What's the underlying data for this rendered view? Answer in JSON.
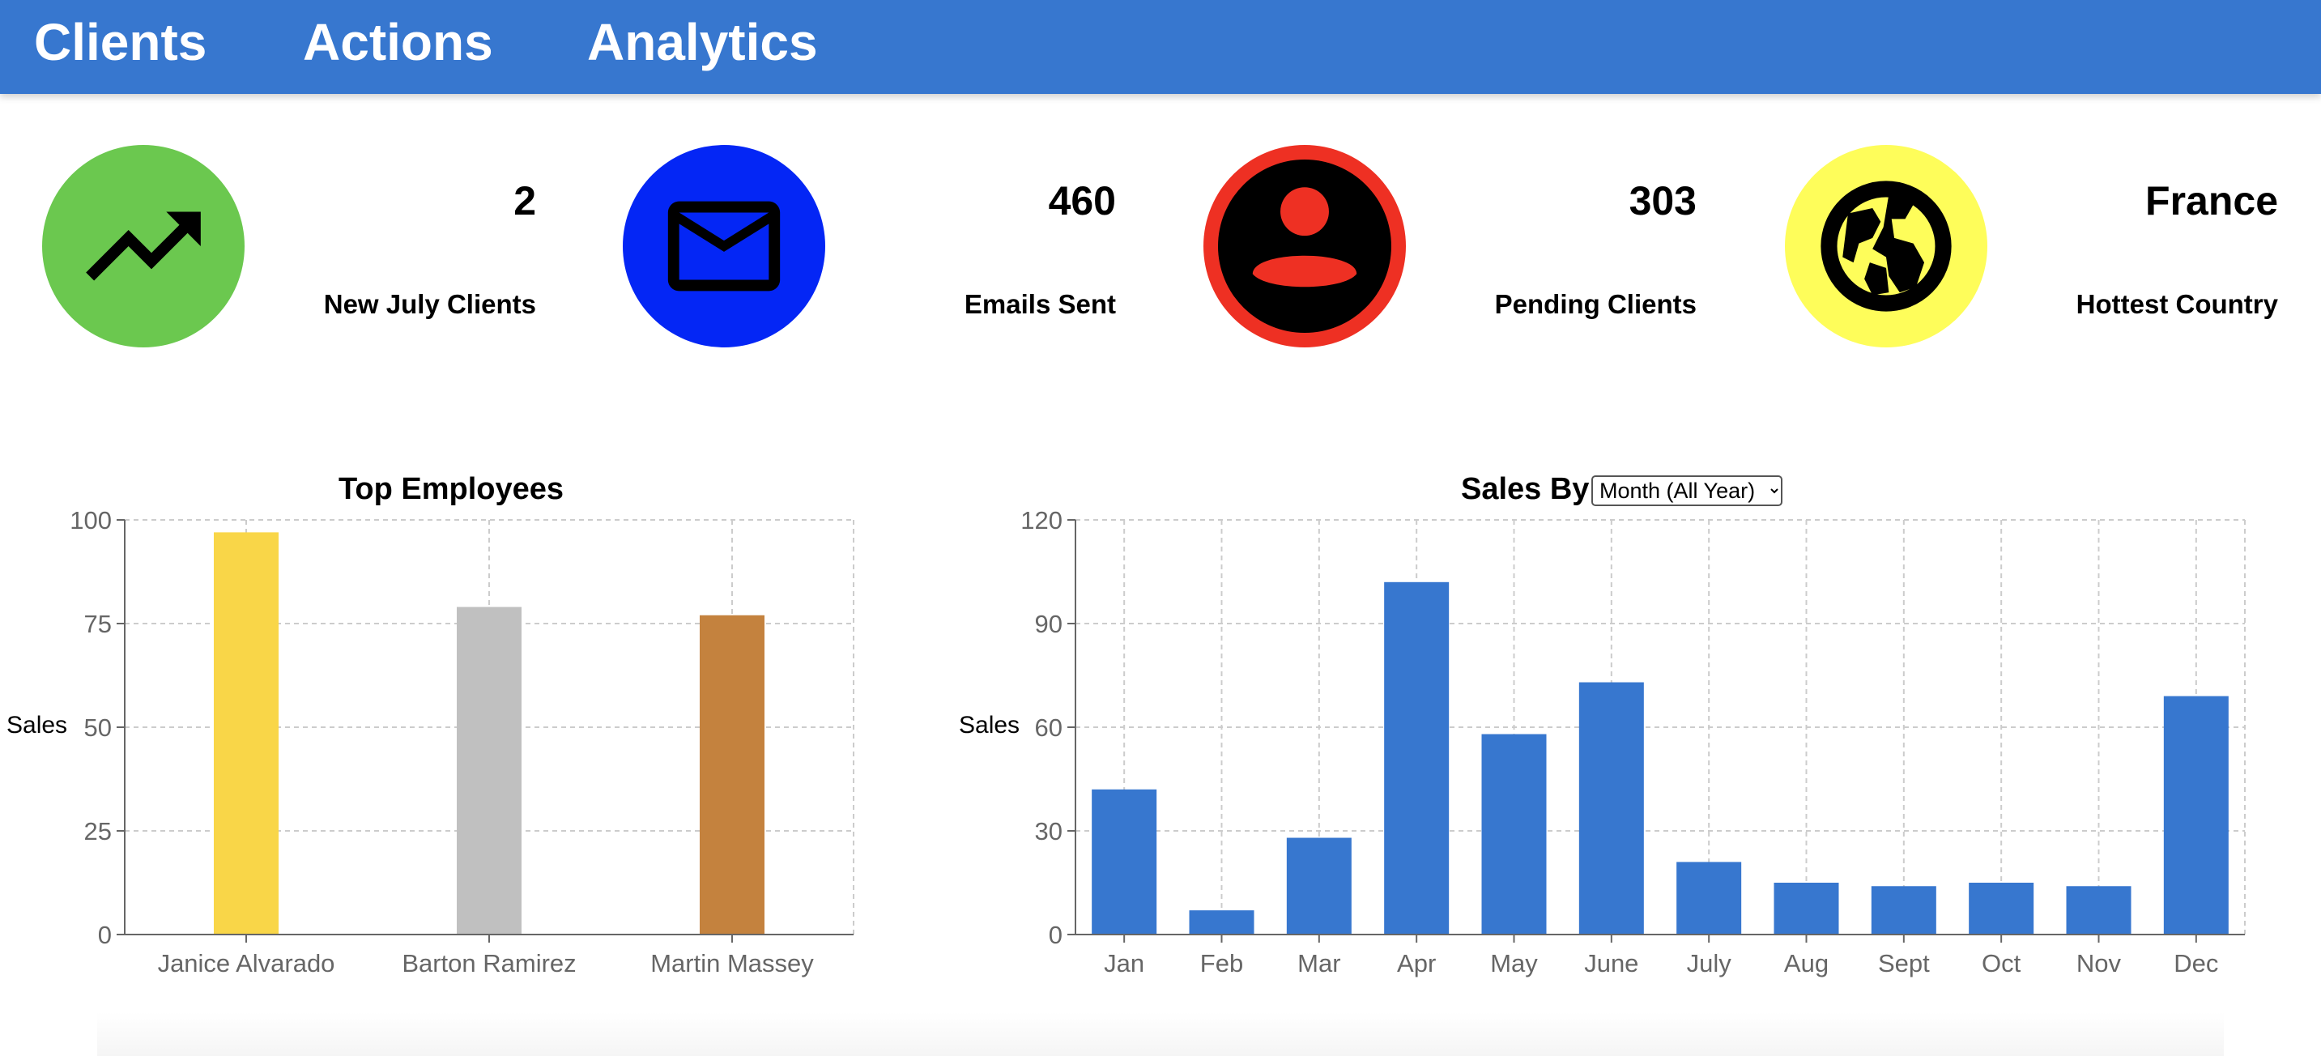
{
  "nav": {
    "tabs": [
      {
        "label": "Clients",
        "active": false
      },
      {
        "label": "Actions",
        "active": false
      },
      {
        "label": "Analytics",
        "active": true
      }
    ],
    "colors": {
      "background": "#3777cf",
      "text": "#ffffff",
      "active": "#f7d54a"
    }
  },
  "stats": [
    {
      "value": "2",
      "label": "New July Clients",
      "icon": "trending-up-icon",
      "color": "#6bc84f"
    },
    {
      "value": "460",
      "label": "Emails Sent",
      "icon": "mail-icon",
      "color": "#0426f5"
    },
    {
      "value": "303",
      "label": "Pending Clients",
      "icon": "account-circle-icon",
      "color": "#ee3023"
    },
    {
      "value": "France",
      "label": "Hottest Country",
      "icon": "globe-icon",
      "color": "#fefd5a"
    }
  ],
  "top_employees": {
    "title": "Top Employees",
    "ylabel": "Sales"
  },
  "sales_by": {
    "title": "Sales By",
    "select": {
      "selected": "Month (All Year)"
    },
    "ylabel": "Sales"
  },
  "chart_data": [
    {
      "type": "bar",
      "title": "Top Employees",
      "ylabel": "Sales",
      "xlabel": "",
      "categories": [
        "Janice Alvarado",
        "Barton Ramirez",
        "Martin Massey"
      ],
      "values": [
        97,
        79,
        77
      ],
      "colors": [
        "#f9d648",
        "#c0c0c0",
        "#c4823e"
      ],
      "ylim": [
        0,
        100
      ],
      "yticks": [
        0,
        25,
        50,
        75,
        100
      ],
      "grid": true
    },
    {
      "type": "bar",
      "title": "Sales By",
      "ylabel": "Sales",
      "xlabel": "",
      "categories": [
        "Jan",
        "Feb",
        "Mar",
        "Apr",
        "May",
        "June",
        "July",
        "Aug",
        "Sept",
        "Oct",
        "Nov",
        "Dec"
      ],
      "values": [
        42,
        7,
        28,
        102,
        58,
        73,
        21,
        15,
        14,
        15,
        14,
        69
      ],
      "color": "#3777cf",
      "ylim": [
        0,
        120
      ],
      "yticks": [
        0,
        30,
        60,
        90,
        120
      ],
      "grid": true
    }
  ]
}
